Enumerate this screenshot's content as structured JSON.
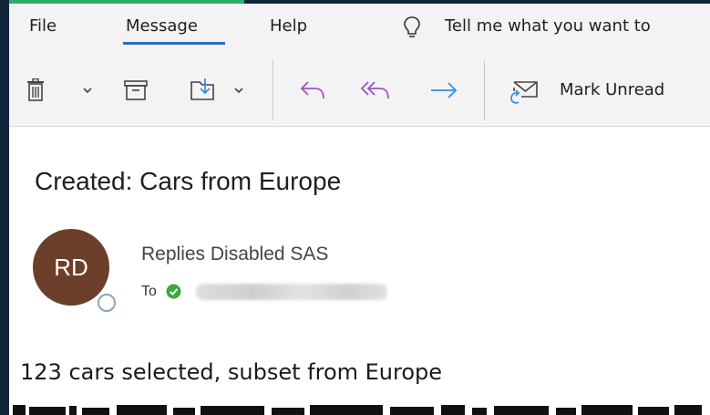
{
  "menu": {
    "file": "File",
    "message": "Message",
    "help": "Help",
    "tell_me": "Tell me what you want to"
  },
  "toolbar": {
    "mark_unread_label": "Mark Unread",
    "icons": [
      "trash-icon",
      "archive-icon",
      "move-to-folder-icon",
      "reply-icon",
      "reply-all-icon",
      "forward-icon",
      "mark-unread-icon"
    ]
  },
  "email": {
    "subject": "Created: Cars from Europe",
    "avatar_initials": "RD",
    "sender": "Replies Disabled SAS",
    "to_label": "To",
    "body": "123 cars selected, subset from Europe"
  },
  "colors": {
    "accent_green": "#2fae6b",
    "tab_underline": "#2b6cc4",
    "reply_purple": "#a44fc7",
    "forward_blue": "#3a8ee6",
    "avatar_bg": "#6b3f2a",
    "presence_check": "#3aa83a"
  }
}
